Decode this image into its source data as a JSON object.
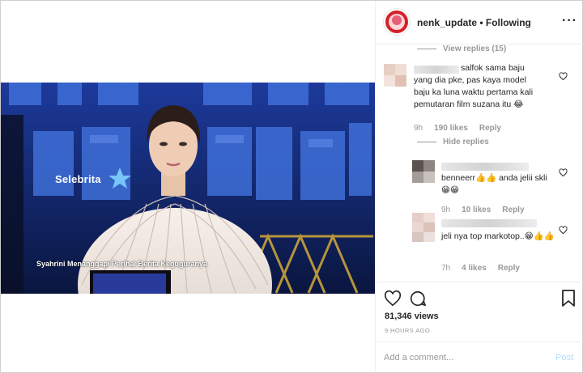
{
  "header": {
    "username": "nenk_update",
    "separator": " • ",
    "follow_status": "Following",
    "more_icon": "more-horizontal-icon"
  },
  "video": {
    "logo_text": "Selebrita",
    "caption": "Syahrini Menanggapi Perihal Berita Keguguranya"
  },
  "comments": {
    "view_replies": "View replies (15)",
    "main": {
      "text": "salfok sama baju yang dia pke, pas kaya model baju ka luna waktu pertama kali pemutaran film suzana itu 😂",
      "time": "9h",
      "likes": "190 likes",
      "reply": "Reply"
    },
    "hide_replies": "Hide replies",
    "replies": [
      {
        "text": "benneerr👍👍 anda jelii skli😁😁",
        "time": "9h",
        "likes": "10 likes",
        "reply": "Reply"
      },
      {
        "text": "jeli nya top markotop..😁👍👍",
        "time": "7h",
        "likes": "4 likes",
        "reply": "Reply"
      }
    ]
  },
  "actions": {
    "views": "81,346 views",
    "posted": "9 HOURS AGO"
  },
  "add_comment": {
    "placeholder": "Add a comment...",
    "post_label": "Post"
  },
  "colors": {
    "link_muted": "#999999",
    "post_disabled": "#b3dbff",
    "video_bg": "#142c7e"
  }
}
